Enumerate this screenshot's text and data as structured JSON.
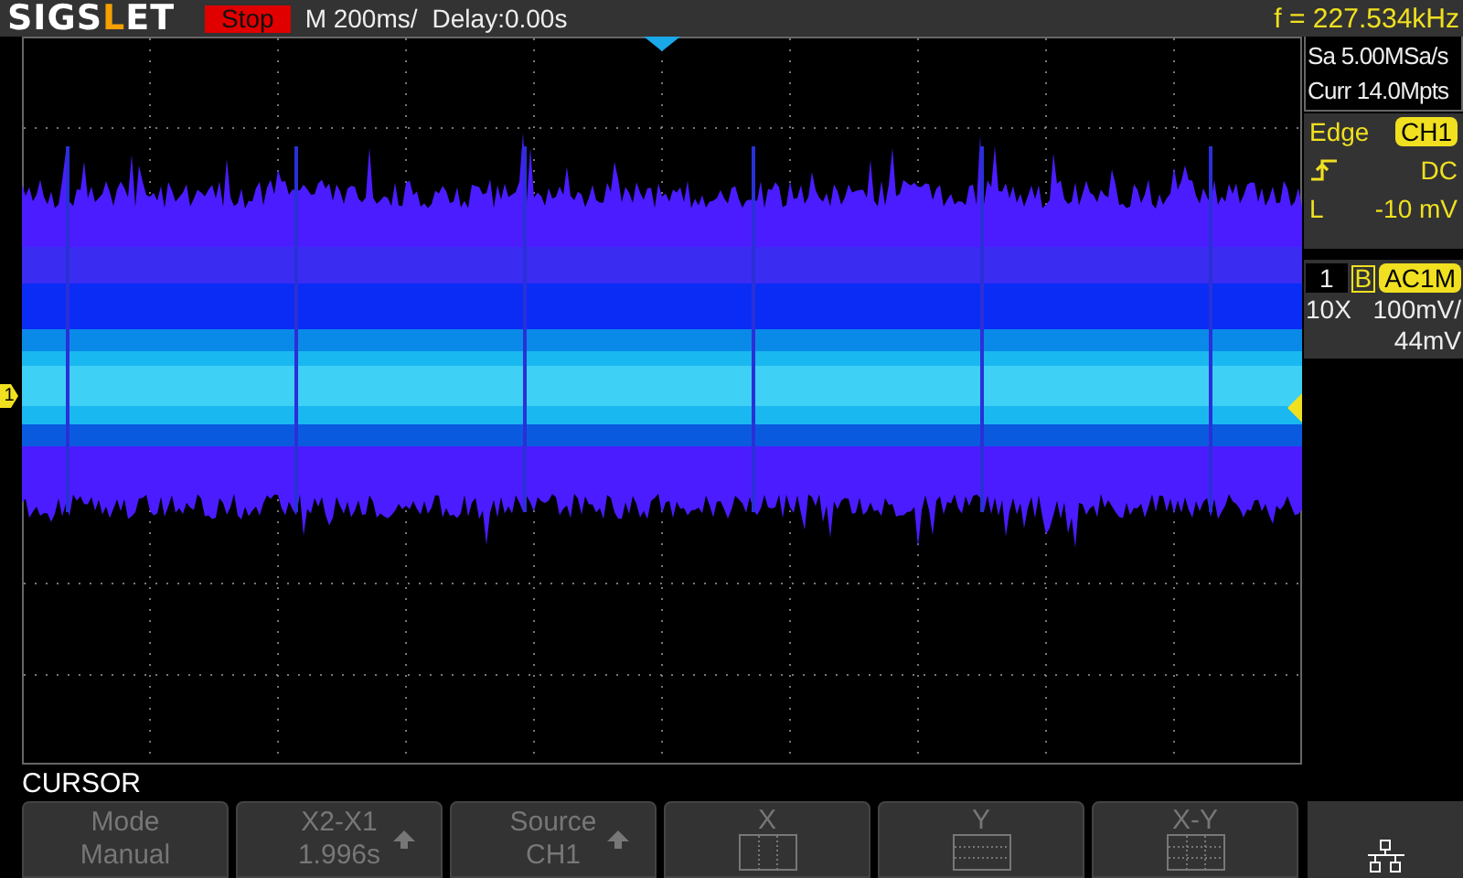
{
  "header": {
    "brand": [
      {
        "text": "SIGS",
        "accent": false
      },
      {
        "text": "L",
        "accent": true
      },
      {
        "text": "ET",
        "accent": false
      }
    ],
    "run_state": {
      "label": "Stop",
      "kind": "stop"
    },
    "timebase": "M 200ms/",
    "delay": "Delay:0.00s",
    "frequency": "f = 227.534kHz"
  },
  "acquisition": {
    "sample_rate": "Sa 5.00MSa/s",
    "memory_depth": "Curr 14.0Mpts"
  },
  "trigger": {
    "type": "Edge",
    "source": "CH1",
    "rising_edge": true,
    "coupling": "DC",
    "level_label": "L",
    "level_value": "-10 mV"
  },
  "channel": {
    "marker": "1",
    "number": "1",
    "bandwidth_limit": "B",
    "coupling": "AC1M",
    "probe": "10X",
    "scale": "100mV/",
    "offset": "44mV"
  },
  "menu": {
    "title": "CURSOR",
    "buttons": [
      {
        "kind": "text",
        "label": "Mode",
        "value": "Manual",
        "arrow": false
      },
      {
        "kind": "text",
        "label": "X2-X1",
        "value": "1.996s",
        "arrow": true
      },
      {
        "kind": "text",
        "label": "Source",
        "value": "CH1",
        "arrow": true
      },
      {
        "kind": "x-grid",
        "label": "X"
      },
      {
        "kind": "y-grid",
        "label": "Y"
      },
      {
        "kind": "xy-grid",
        "label": "X-Y"
      }
    ]
  }
}
